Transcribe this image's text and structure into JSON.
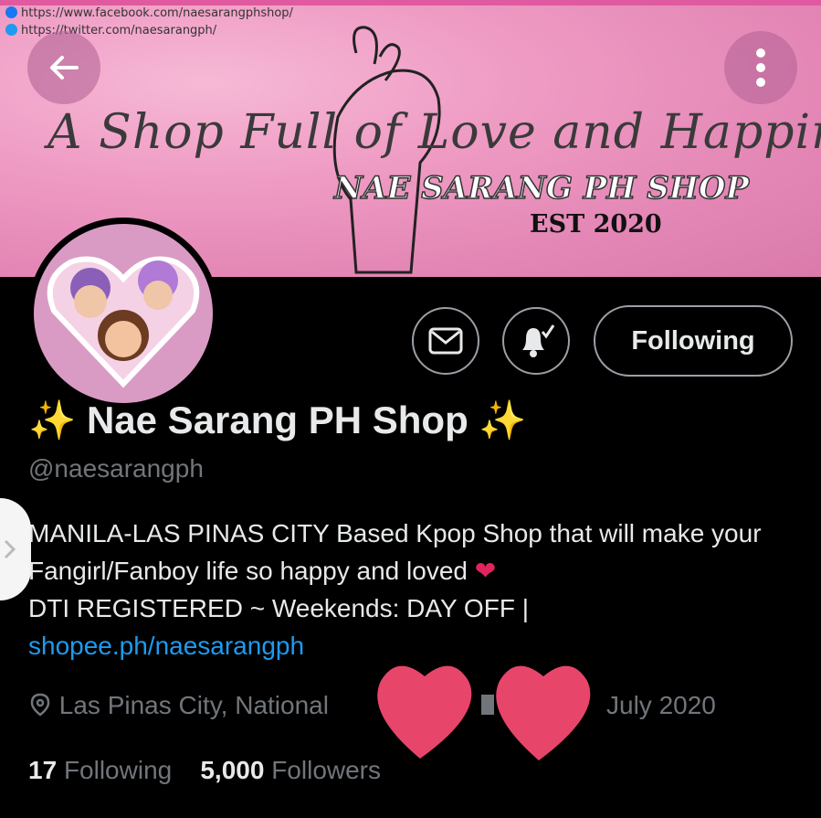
{
  "banner": {
    "facebook_url": "https://www.facebook.com/naesarangphshop/",
    "twitter_url": "https://twitter.com/naesarangph/",
    "tagline": "A Shop Full of Love and Happiness",
    "shop_name": "NAE SARANG PH SHOP",
    "est": "EST 2020"
  },
  "actions": {
    "following_label": "Following"
  },
  "profile": {
    "display_name": "Nae Sarang PH Shop",
    "sparkle": "✨",
    "handle": "@naesarangph",
    "bio_text": "MANILA-LAS PINAS CITY Based Kpop Shop that will make your Fangirl/Fanboy life so happy and loved",
    "heart": "❤",
    "bio_line3": "DTI REGISTERED ~ Weekends: DAY OFF | ",
    "bio_link": "shopee.ph/naesarangph",
    "location": "Las Pinas City, National",
    "joined_partial": "July 2020",
    "following_count": "17",
    "following_label": "Following",
    "followers_count": "5,000",
    "followers_label": "Followers"
  },
  "colors": {
    "link": "#1d9bf0",
    "banner_pink": "#ef9cc4",
    "heart_sticker": "#e8456a"
  },
  "icons": [
    "facebook-icon",
    "twitter-icon",
    "back-arrow-icon",
    "more-vertical-icon",
    "mail-icon",
    "bell-icon",
    "location-icon",
    "calendar-icon",
    "sparkle-icon",
    "heart-icon",
    "chevron-right-icon"
  ]
}
